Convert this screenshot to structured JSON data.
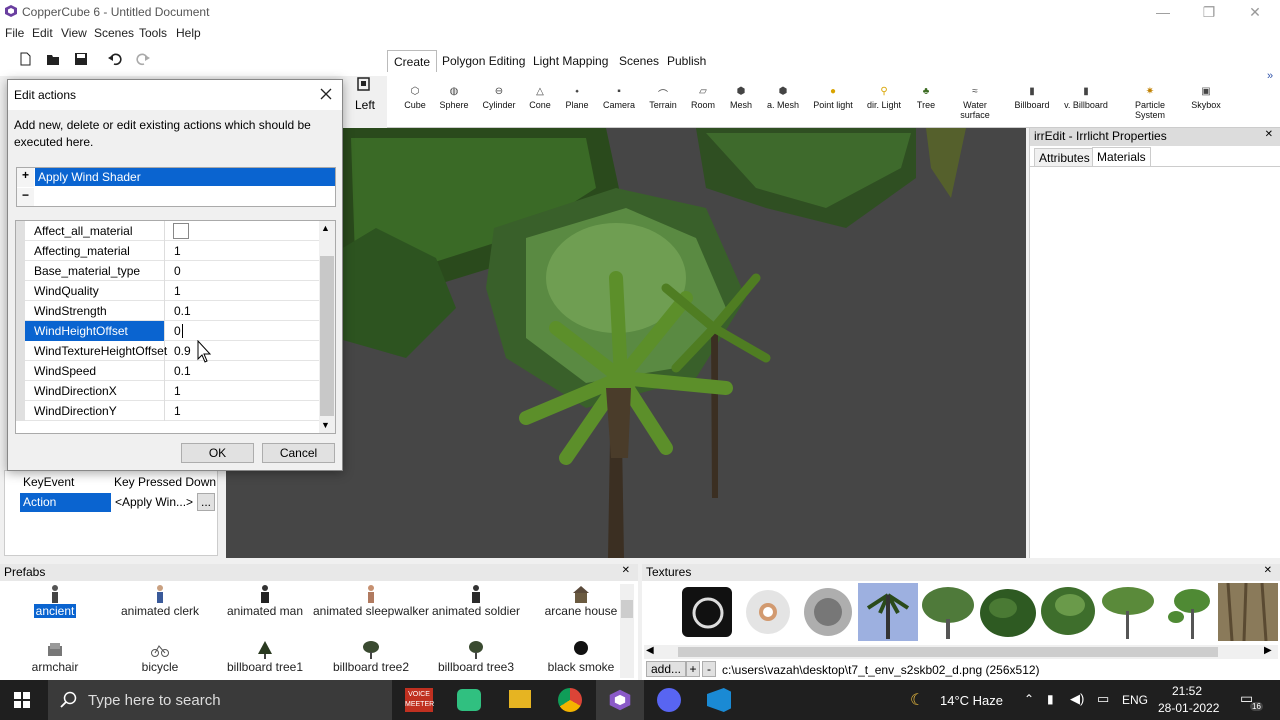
{
  "window": {
    "title": "CopperCube 6 - Untitled Document",
    "minimize": "—",
    "maximize": "❐",
    "close": "✕"
  },
  "menu": [
    "File",
    "Edit",
    "View",
    "Scenes",
    "Tools",
    "Help"
  ],
  "view": {
    "label": "Left"
  },
  "ribbon_tabs": [
    "Create",
    "Polygon Editing",
    "Light Mapping",
    "Scenes",
    "Publish"
  ],
  "create_buttons": [
    "Cube",
    "Sphere",
    "Cylinder",
    "Cone",
    "Plane",
    "Camera",
    "Terrain",
    "Room",
    "Mesh",
    "a. Mesh",
    "Point light",
    "dir. Light",
    "Tree",
    "Water surface",
    "Billboard",
    "v. Billboard",
    "Particle System",
    "Skybox"
  ],
  "right_panel": {
    "title": "irrEdit - Irrlicht Properties",
    "tabs": [
      "Attributes",
      "Materials"
    ],
    "close": "✕"
  },
  "left_props": [
    {
      "name": "KeyEvent",
      "value": "Key Pressed Down"
    },
    {
      "name": "Action",
      "value": "<Apply Win...>",
      "button": "..."
    }
  ],
  "dialog": {
    "title": "Edit actions",
    "description": "Add new, delete or edit existing actions which should be executed here.",
    "add": "+",
    "remove": "−",
    "action_item": "Apply Wind Shader",
    "properties": [
      {
        "name": "Affect_all_material",
        "value": ""
      },
      {
        "name": "Affecting_material",
        "value": "1"
      },
      {
        "name": "Base_material_type",
        "value": "0"
      },
      {
        "name": "WindQuality",
        "value": "1"
      },
      {
        "name": "WindStrength",
        "value": "0.1"
      },
      {
        "name": "WindHeightOffset",
        "value": "0"
      },
      {
        "name": "WindTextureHeightOffset",
        "value": "0.9"
      },
      {
        "name": "WindSpeed",
        "value": "0.1"
      },
      {
        "name": "WindDirectionX",
        "value": "1"
      },
      {
        "name": "WindDirectionY",
        "value": "1"
      }
    ],
    "ok": "OK",
    "cancel": "Cancel"
  },
  "prefabs": {
    "title": "Prefabs",
    "close": "✕",
    "items": [
      "ancient",
      "animated clerk",
      "animated man",
      "animated sleepwalker",
      "animated soldier",
      "arcane house",
      "armchair",
      "bicycle",
      "billboard tree1",
      "billboard tree2",
      "billboard tree3",
      "black smoke"
    ]
  },
  "textures": {
    "title": "Textures",
    "close": "✕",
    "add": "add...",
    "plus": "+",
    "minus": "-",
    "path": "c:\\users\\vazah\\desktop\\t7_t_env_s2skb02_d.png (256x512)"
  },
  "taskbar": {
    "search": "Type here to search",
    "voicemeeter": "VOICE MEETER",
    "weather": "14°C  Haze",
    "lang": "ENG",
    "time": "21:52",
    "date": "28-01-2022",
    "notifications": "16"
  }
}
